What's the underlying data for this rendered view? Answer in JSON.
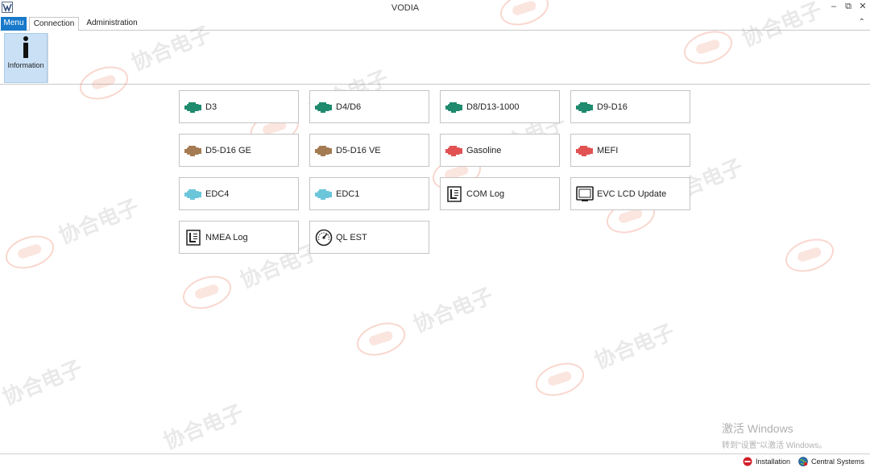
{
  "window": {
    "title": "VODIA"
  },
  "tabs": {
    "menu": "Menu",
    "connection": "Connection",
    "administration": "Administration"
  },
  "ribbon": {
    "information_label": "Information"
  },
  "tiles": [
    {
      "label": "D3",
      "icon": "engine-icon",
      "color": "#1f8a6e"
    },
    {
      "label": "D4/D6",
      "icon": "engine-icon",
      "color": "#1f8a6e"
    },
    {
      "label": "D8/D13-1000",
      "icon": "engine-icon",
      "color": "#1f8a6e"
    },
    {
      "label": "D9-D16",
      "icon": "engine-icon",
      "color": "#1f8a6e"
    },
    {
      "label": "D5-D16 GE",
      "icon": "engine-icon",
      "color": "#a47b52"
    },
    {
      "label": "D5-D16 VE",
      "icon": "engine-icon",
      "color": "#a47b52"
    },
    {
      "label": "Gasoline",
      "icon": "engine-icon",
      "color": "#e25252"
    },
    {
      "label": "MEFI",
      "icon": "engine-icon",
      "color": "#e25252"
    },
    {
      "label": "EDC4",
      "icon": "engine-icon",
      "color": "#6cc6da"
    },
    {
      "label": "EDC1",
      "icon": "engine-icon",
      "color": "#6cc6da"
    },
    {
      "label": "COM Log",
      "icon": "log-document-icon",
      "color": "#222222"
    },
    {
      "label": "EVC LCD Update",
      "icon": "display-monitor-icon",
      "color": "#222222"
    },
    {
      "label": "NMEA Log",
      "icon": "log-document-icon",
      "color": "#222222"
    },
    {
      "label": "QL EST",
      "icon": "gauge-icon",
      "color": "#222222"
    }
  ],
  "watermark": {
    "text": "协合电子"
  },
  "activation": {
    "title": "激活 Windows",
    "subtitle": "转到\"设置\"以激活 Windows。"
  },
  "status": {
    "installation": "Installation",
    "central_systems": "Central Systems"
  },
  "colors": {
    "menu_tab": "#1979ca",
    "ribbon_selected": "#c9e0f5"
  }
}
